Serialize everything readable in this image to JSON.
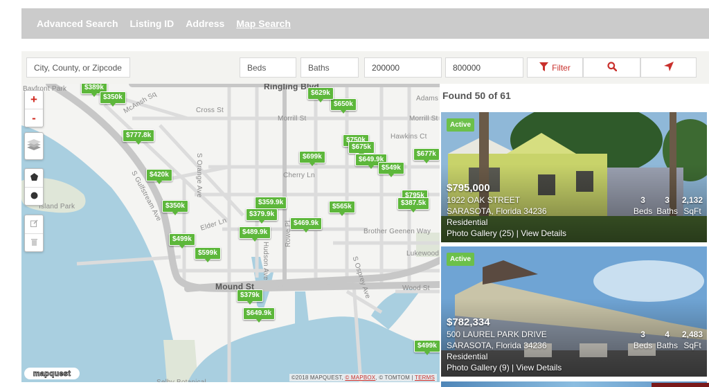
{
  "nav": {
    "items": [
      {
        "label": "Advanced Search",
        "active": false
      },
      {
        "label": "Listing ID",
        "active": false
      },
      {
        "label": "Address",
        "active": false
      },
      {
        "label": "Map Search",
        "active": true
      }
    ]
  },
  "filters": {
    "location": {
      "placeholder": "City, County, or Zipcode",
      "value": ""
    },
    "beds": {
      "placeholder": "Beds",
      "value": ""
    },
    "baths": {
      "placeholder": "Baths",
      "value": ""
    },
    "min_price": {
      "value": "200000"
    },
    "max_price": {
      "value": "800000"
    },
    "filter_label": "Filter",
    "icons": {
      "filter": "funnel-icon",
      "search": "search-icon",
      "locate": "location-arrow-icon"
    }
  },
  "colors": {
    "accent_red": "#c9302c",
    "pin_green": "#5db73b",
    "badge_green": "#6cc04a",
    "nav_bg": "#cbcbcb",
    "water": "#a9cfe0"
  },
  "map": {
    "controls": {
      "zoom_in": "+",
      "zoom_out": "-",
      "layers_icon": "layers-icon",
      "draw_polygon_icon": "polygon-icon",
      "draw_circle_icon": "circle-icon",
      "edit_icon": "edit-icon",
      "delete_icon": "trash-icon"
    },
    "street_labels": [
      {
        "text": "Ringling Blvd"
      },
      {
        "text": "Cross St"
      },
      {
        "text": "Morrill St"
      },
      {
        "text": "Morrill St"
      },
      {
        "text": "Adams Ln"
      },
      {
        "text": "Hawkins Ct"
      },
      {
        "text": "Cherry Ln"
      },
      {
        "text": "Elder Ln"
      },
      {
        "text": "Brother Geenen Way"
      },
      {
        "text": "Mound St"
      },
      {
        "text": "Wood St"
      },
      {
        "text": "S Orange Ave"
      },
      {
        "text": "Hudson Ave"
      },
      {
        "text": "Rowe Pl"
      },
      {
        "text": "S Osprey Ave"
      },
      {
        "text": "McAnsh Sq"
      },
      {
        "text": "S Gulfstream Ave"
      },
      {
        "text": "Island Park"
      },
      {
        "text": "Bayfront Park"
      },
      {
        "text": "Lukewood"
      },
      {
        "text": "Selby Botanical"
      }
    ],
    "pins": [
      {
        "label": "$389k"
      },
      {
        "label": "$350k"
      },
      {
        "label": "$777.8k"
      },
      {
        "label": "$420k"
      },
      {
        "label": "$350k"
      },
      {
        "label": "$499k"
      },
      {
        "label": "$599k"
      },
      {
        "label": "$629k"
      },
      {
        "label": "$650k"
      },
      {
        "label": "$750k"
      },
      {
        "label": "$675k"
      },
      {
        "label": "$699k"
      },
      {
        "label": "$649.9k"
      },
      {
        "label": "$549k"
      },
      {
        "label": "$677k"
      },
      {
        "label": "$795k"
      },
      {
        "label": "$387.5k"
      },
      {
        "label": "$565k"
      },
      {
        "label": "$359.9k"
      },
      {
        "label": "$379.9k"
      },
      {
        "label": "$469.9k"
      },
      {
        "label": "$489.9k"
      },
      {
        "label": "$379k"
      },
      {
        "label": "$649.9k"
      },
      {
        "label": "$499k"
      }
    ],
    "logo": "mapquest",
    "attribution": {
      "prefix": "©2018 MAPQUEST, ",
      "mapbox": "© MAPBOX",
      "middle": ", © TOMTOM | ",
      "terms": "TERMS"
    }
  },
  "results": {
    "found_text": "Found 50 of 61",
    "listings": [
      {
        "status": "Active",
        "price": "$795,000",
        "street": "1922 OAK STREET",
        "city_line": "SARASOTA, Florida 34236",
        "type": "Residential",
        "gallery_link": "Photo Gallery (25)",
        "separator": " | ",
        "details_link": "View Details",
        "beds": "3",
        "beds_label": "Beds",
        "baths": "3",
        "baths_label": "Baths",
        "sqft": "2,132",
        "sqft_label": "SqFt"
      },
      {
        "status": "Active",
        "price": "$782,334",
        "street": "500 LAUREL PARK DRIVE",
        "city_line": "SARASOTA, Florida 34236",
        "type": "Residential",
        "gallery_link": "Photo Gallery (9)",
        "separator": " | ",
        "details_link": "View Details",
        "beds": "3",
        "beds_label": "Beds",
        "baths": "4",
        "baths_label": "Baths",
        "sqft": "2,483",
        "sqft_label": "SqFt"
      }
    ]
  }
}
